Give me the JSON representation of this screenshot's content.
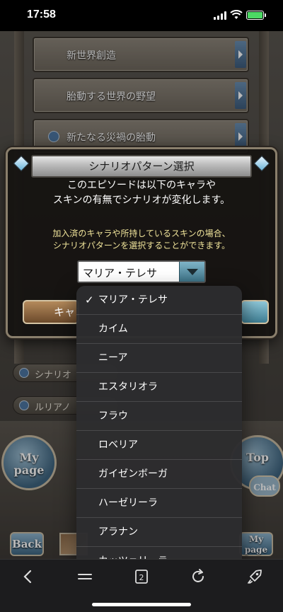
{
  "status": {
    "time": "17:58"
  },
  "episodes": [
    {
      "label": "新世界創造"
    },
    {
      "label": "胎動する世界の野望"
    },
    {
      "label": "新たなる災禍の胎動"
    }
  ],
  "sub_items": [
    {
      "label": "シナリオ"
    },
    {
      "label": "ルリアノ"
    }
  ],
  "footer": {
    "mypage_left": "My page",
    "top": "Top",
    "chat": "Chat",
    "back": "Back",
    "mypage_right": "My page"
  },
  "modal": {
    "title": "シナリオパターン選択",
    "body_line1": "このエピソードは以下のキャラや",
    "body_line2": "スキンの有無でシナリオが変化します。",
    "note_line1": "加入済のキャラや所持しているスキンの場合、",
    "note_line2": "シナリオパターンを選択することができます。",
    "selected": "マリア・テレサ",
    "cancel_label": "キャンセル"
  },
  "dropdown": {
    "check_glyph": "✓",
    "options": [
      "マリア・テレサ",
      "カイム",
      "ニーア",
      "エスタリオラ",
      "フラウ",
      "ロベリア",
      "ガイゼンボーガ",
      "ハーゼリーラ",
      "アラナン",
      "カッツェリーラ"
    ],
    "selected_index": 0
  },
  "toolbar": {
    "icons": [
      "back-arrow-icon",
      "menu-icon",
      "tabs-icon",
      "reload-icon",
      "rocket-icon"
    ],
    "tabs_count": "2"
  },
  "colors": {
    "note_yellow": "#efe39a",
    "select_accent": "#7fb4c8",
    "dropdown_bg": "#2c2c2e"
  }
}
